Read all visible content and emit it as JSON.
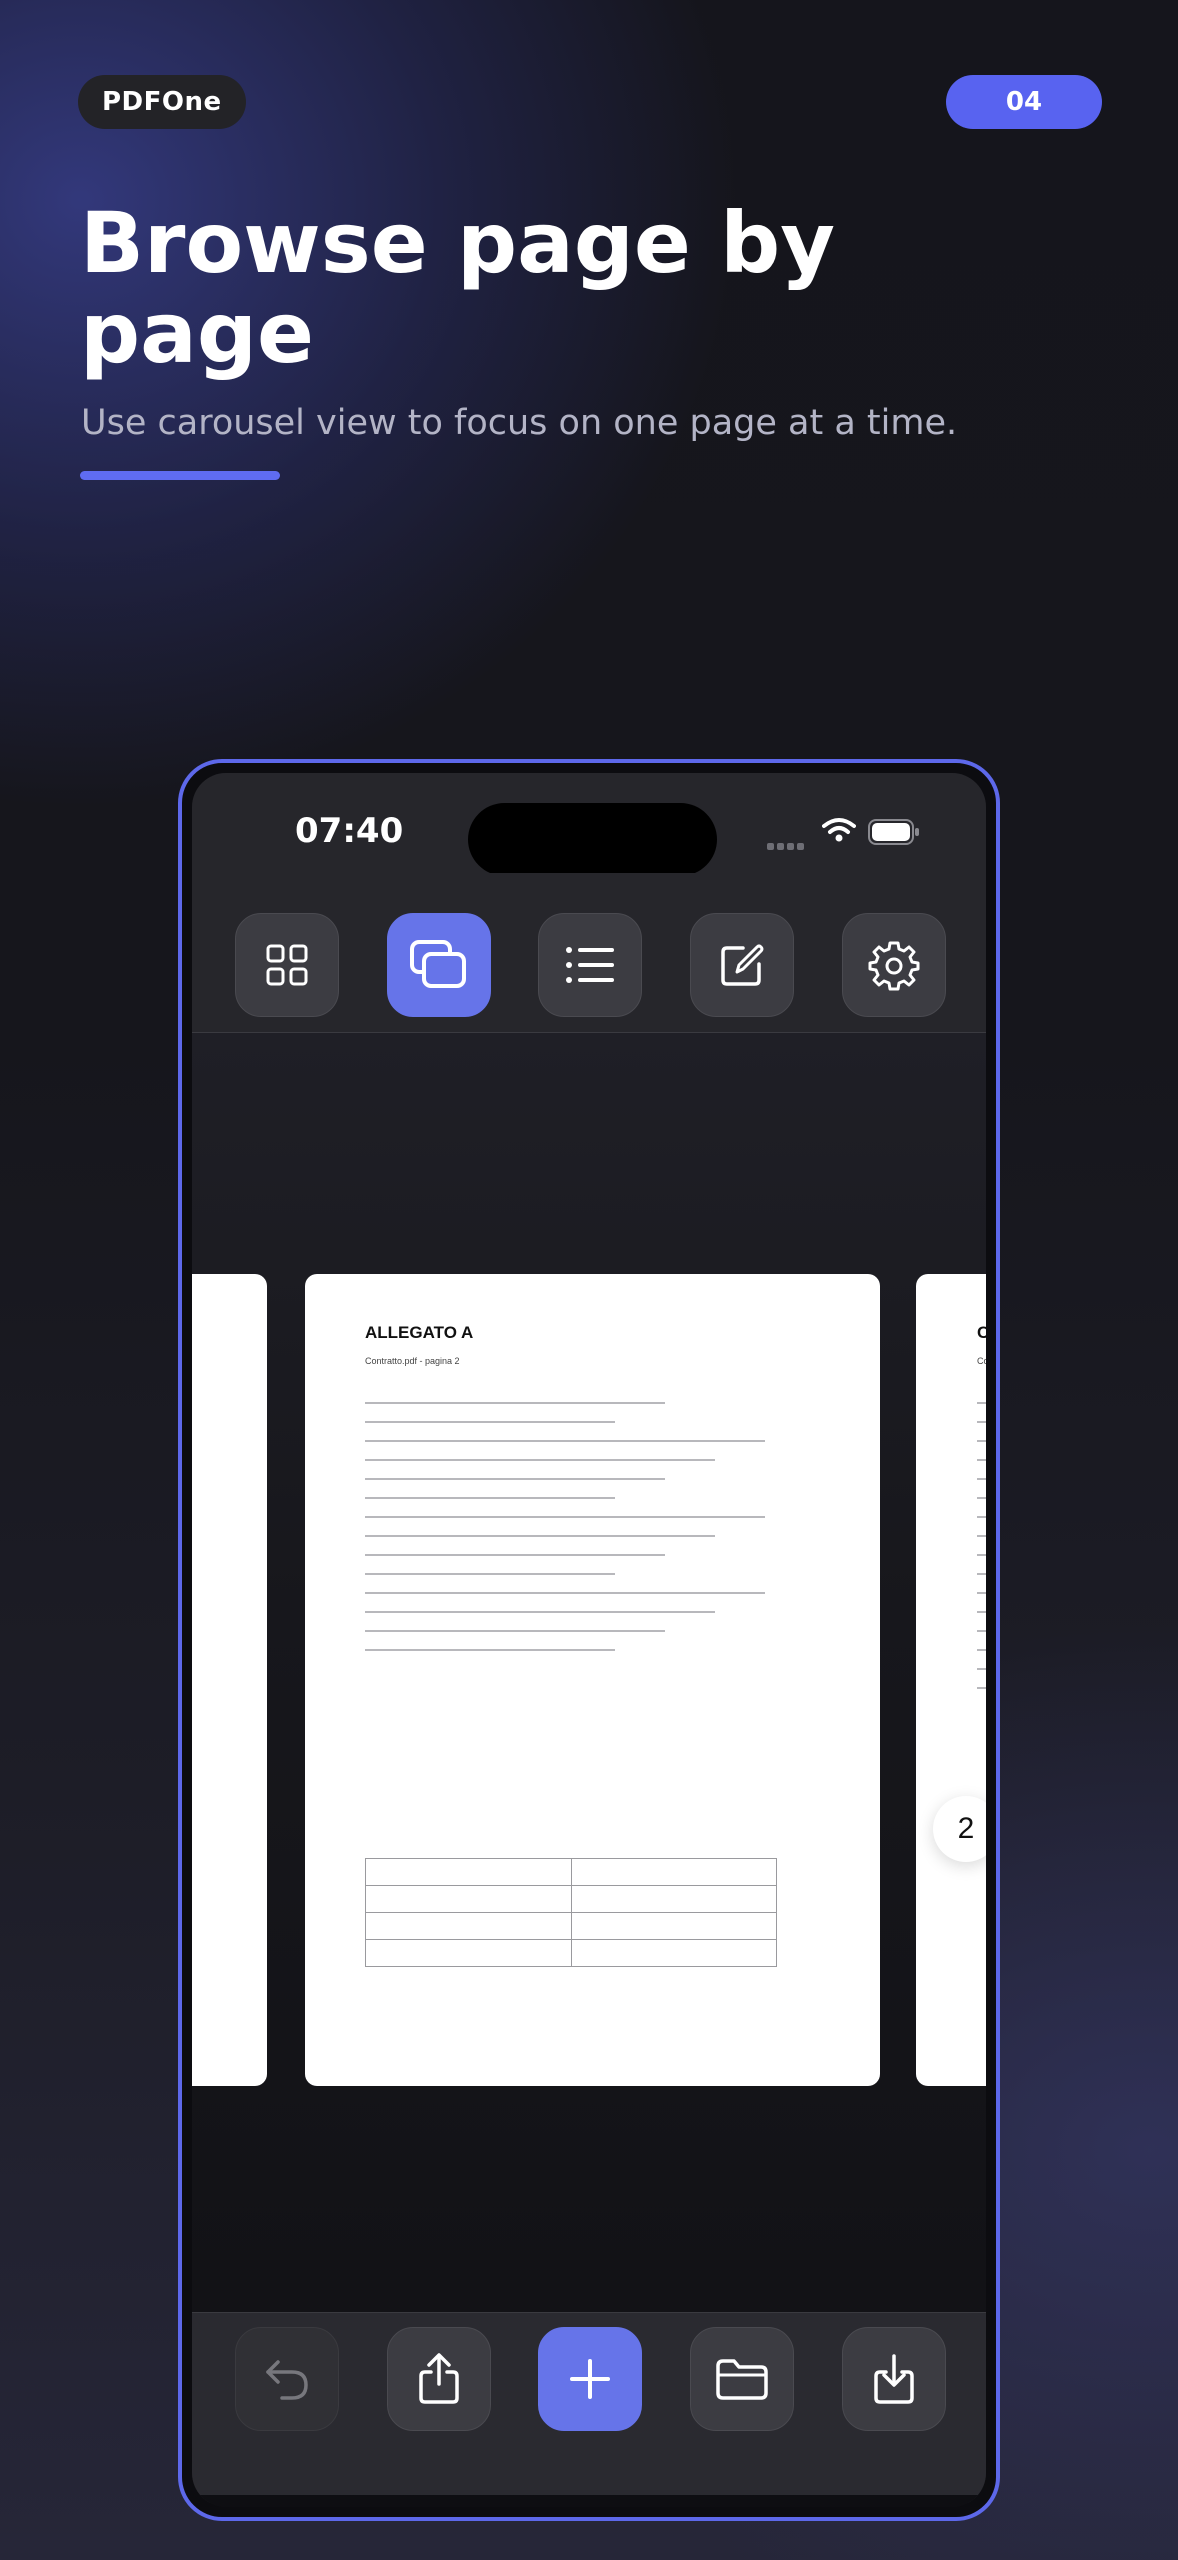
{
  "promo": {
    "brand": "PDFOne",
    "step": "04",
    "headline": "Browse page by page",
    "subtitle": "Use carousel view to focus on one page at a time.",
    "accent_color": "#5f6cf2"
  },
  "status_bar": {
    "time": "07:40",
    "icons": [
      "signal-icon",
      "wifi-icon",
      "battery-icon"
    ]
  },
  "top_toolbar": {
    "items": [
      {
        "icon": "grid-icon",
        "name": "Grid view",
        "active": false
      },
      {
        "icon": "carousel-icon",
        "name": "Carousel view",
        "active": true
      },
      {
        "icon": "list-icon",
        "name": "List view",
        "active": false
      },
      {
        "icon": "edit-icon",
        "name": "Edit",
        "active": false
      },
      {
        "icon": "gear-icon",
        "name": "Settings",
        "active": false
      }
    ]
  },
  "carousel": {
    "current_page": {
      "title": "ALLEGATO A",
      "subtitle": "Contratto.pdf - pagina 2",
      "number": "2"
    },
    "next_page": {
      "title": "CO",
      "subtitle": "Con"
    }
  },
  "bottom_toolbar": {
    "items": [
      {
        "icon": "undo-icon",
        "name": "Undo",
        "disabled": true
      },
      {
        "icon": "share-icon",
        "name": "Share"
      },
      {
        "icon": "plus-icon",
        "name": "Add",
        "primary": true
      },
      {
        "icon": "folder-icon",
        "name": "Open folder"
      },
      {
        "icon": "download-icon",
        "name": "Save"
      }
    ]
  }
}
